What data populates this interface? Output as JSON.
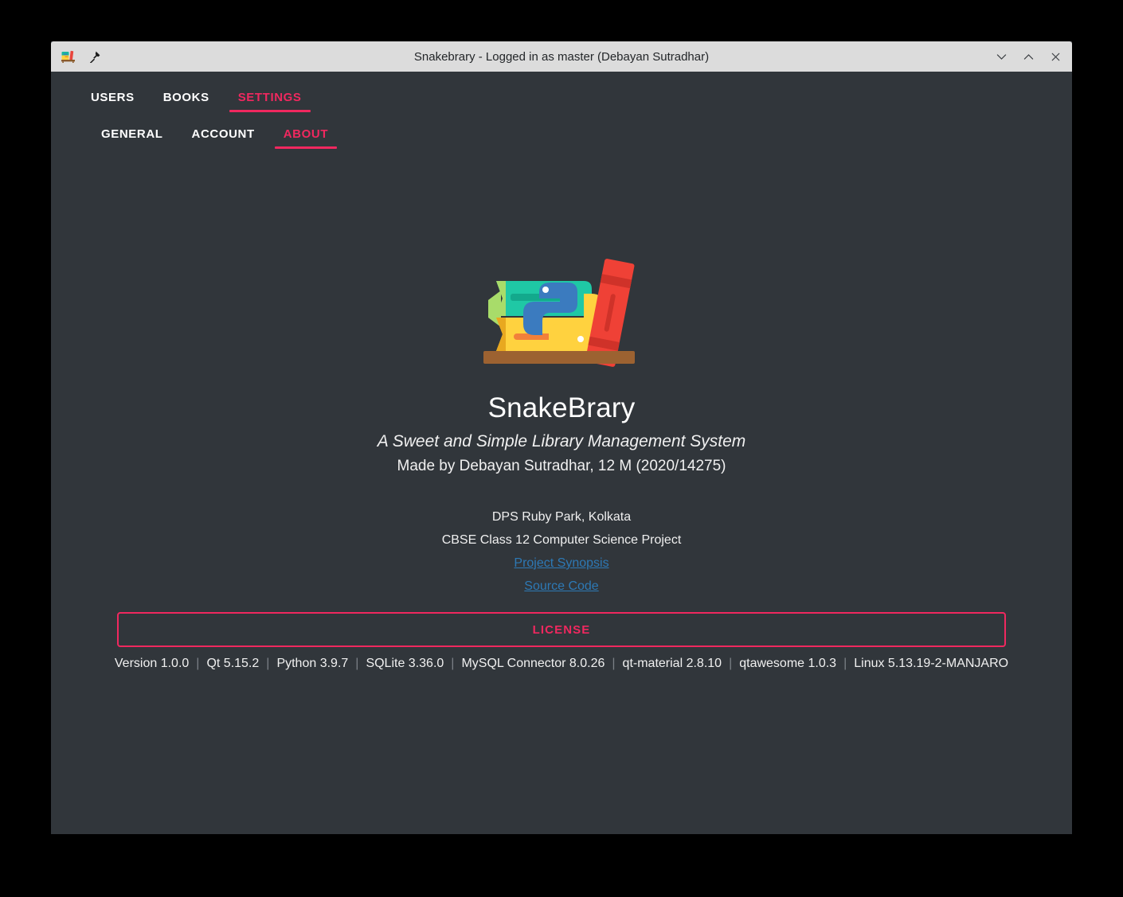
{
  "window": {
    "title": "Snakebrary - Logged in as master (Debayan Sutradhar)",
    "app_icon": "books-shelf-icon",
    "pin_icon": "pin-icon",
    "controls": [
      {
        "name": "minimize",
        "glyph": "chevron-down-icon"
      },
      {
        "name": "maximize",
        "glyph": "chevron-up-icon"
      },
      {
        "name": "close",
        "glyph": "close-icon"
      }
    ]
  },
  "main_tabs": [
    {
      "label": "USERS",
      "active": false
    },
    {
      "label": "BOOKS",
      "active": false
    },
    {
      "label": "SETTINGS",
      "active": true
    }
  ],
  "sub_tabs": [
    {
      "label": "GENERAL",
      "active": false
    },
    {
      "label": "ACCOUNT",
      "active": false
    },
    {
      "label": "ABOUT",
      "active": true
    }
  ],
  "about": {
    "logo_icon": "snakebrary-books-python-logo",
    "app_name": "SnakeBrary",
    "tagline": "A Sweet and Simple Library Management System",
    "author": "Made by Debayan Sutradhar, 12 M (2020/14275)",
    "school": "DPS Ruby Park, Kolkata",
    "project": "CBSE Class 12 Computer Science Project",
    "links": [
      {
        "label": "Project Synopsis"
      },
      {
        "label": "Source Code"
      }
    ],
    "license_label": "LICENSE",
    "versions": [
      "Version 1.0.0",
      "Qt 5.15.2",
      "Python 3.9.7",
      "SQLite 3.36.0",
      "MySQL Connector 8.0.26",
      "qt-material 2.8.10",
      "qtawesome 1.0.3",
      "Linux 5.13.19-2-MANJARO"
    ],
    "version_separator": "|"
  },
  "colors": {
    "accent": "#f0285f",
    "background": "#31363b",
    "titlebar": "#dcdcdc",
    "link": "#2d79b5",
    "text": "#ffffff",
    "desktop": "#000000"
  }
}
